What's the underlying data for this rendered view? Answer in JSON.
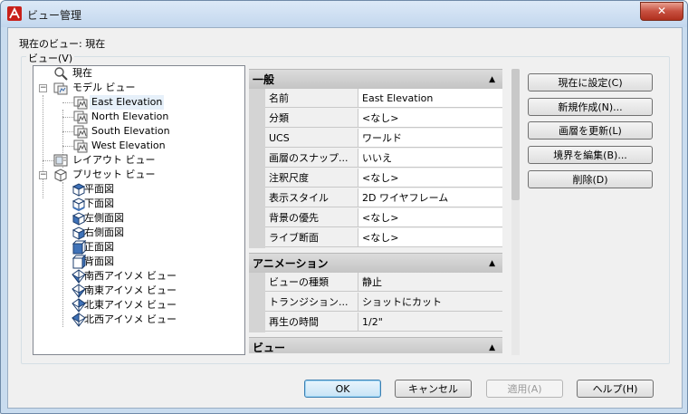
{
  "window": {
    "title": "ビュー管理",
    "close_label": "✕"
  },
  "current_view": "現在のビュー: 現在",
  "group_label": "ビュー(V)",
  "tree": [
    {
      "label": "現在",
      "level": 1,
      "icon": "magnifier-icon"
    },
    {
      "label": "モデル ビュー",
      "level": 1,
      "icon": "model-views-icon",
      "expander": "−"
    },
    {
      "label": "East Elevation",
      "level": 2,
      "icon": "named-view-icon",
      "selected": true
    },
    {
      "label": "North Elevation",
      "level": 2,
      "icon": "named-view-icon"
    },
    {
      "label": "South Elevation",
      "level": 2,
      "icon": "named-view-icon"
    },
    {
      "label": "West Elevation",
      "level": 2,
      "icon": "named-view-icon"
    },
    {
      "label": "レイアウト ビュー",
      "level": 1,
      "icon": "layout-views-icon"
    },
    {
      "label": "プリセット ビュー",
      "level": 1,
      "icon": "preset-views-icon",
      "expander": "−"
    },
    {
      "label": "平面図",
      "level": 2,
      "icon": "cube-top-icon"
    },
    {
      "label": "下面図",
      "level": 2,
      "icon": "cube-bottom-icon"
    },
    {
      "label": "左側面図",
      "level": 2,
      "icon": "cube-left-icon"
    },
    {
      "label": "右側面図",
      "level": 2,
      "icon": "cube-right-icon"
    },
    {
      "label": "正面図",
      "level": 2,
      "icon": "cube-front-icon"
    },
    {
      "label": "背面図",
      "level": 2,
      "icon": "cube-back-icon"
    },
    {
      "label": "南西アイソメ ビュー",
      "level": 2,
      "icon": "cube-iso-icon"
    },
    {
      "label": "南東アイソメ ビュー",
      "level": 2,
      "icon": "cube-iso-icon"
    },
    {
      "label": "北東アイソメ ビュー",
      "level": 2,
      "icon": "cube-iso-icon"
    },
    {
      "label": "北西アイソメ ビュー",
      "level": 2,
      "icon": "cube-iso-icon"
    }
  ],
  "properties": {
    "general": {
      "title": "一般",
      "rows": [
        {
          "name": "名前",
          "value": "East Elevation"
        },
        {
          "name": "分類",
          "value": "<なし>"
        },
        {
          "name": "UCS",
          "value": "ワールド"
        },
        {
          "name": "画層のスナップ...",
          "value": "いいえ"
        },
        {
          "name": "注釈尺度",
          "value": "<なし>"
        },
        {
          "name": "表示スタイル",
          "value": "2D ワイヤフレーム"
        },
        {
          "name": "背景の優先",
          "value": "<なし>"
        },
        {
          "name": "ライブ断面",
          "value": "<なし>"
        }
      ]
    },
    "animation": {
      "title": "アニメーション",
      "rows": [
        {
          "name": "ビューの種類",
          "value": "静止"
        },
        {
          "name": "トランジション...",
          "value": "ショットにカット"
        },
        {
          "name": "再生の時間",
          "value": "1/2\""
        }
      ]
    },
    "view": {
      "title": "ビュー"
    },
    "collapse_glyph": "▲"
  },
  "side_buttons": [
    {
      "label": "現在に設定(C)"
    },
    {
      "label": "新規作成(N)..."
    },
    {
      "label": "画層を更新(L)"
    },
    {
      "label": "境界を編集(B)..."
    },
    {
      "label": "削除(D)"
    }
  ],
  "footer": {
    "ok": "OK",
    "cancel": "キャンセル",
    "apply": "適用(A)",
    "help": "ヘルプ(H)"
  },
  "colors": {
    "selection": "#e6f0fa",
    "default_button_border": "#3c7fb1",
    "close_button": "#c75040"
  }
}
